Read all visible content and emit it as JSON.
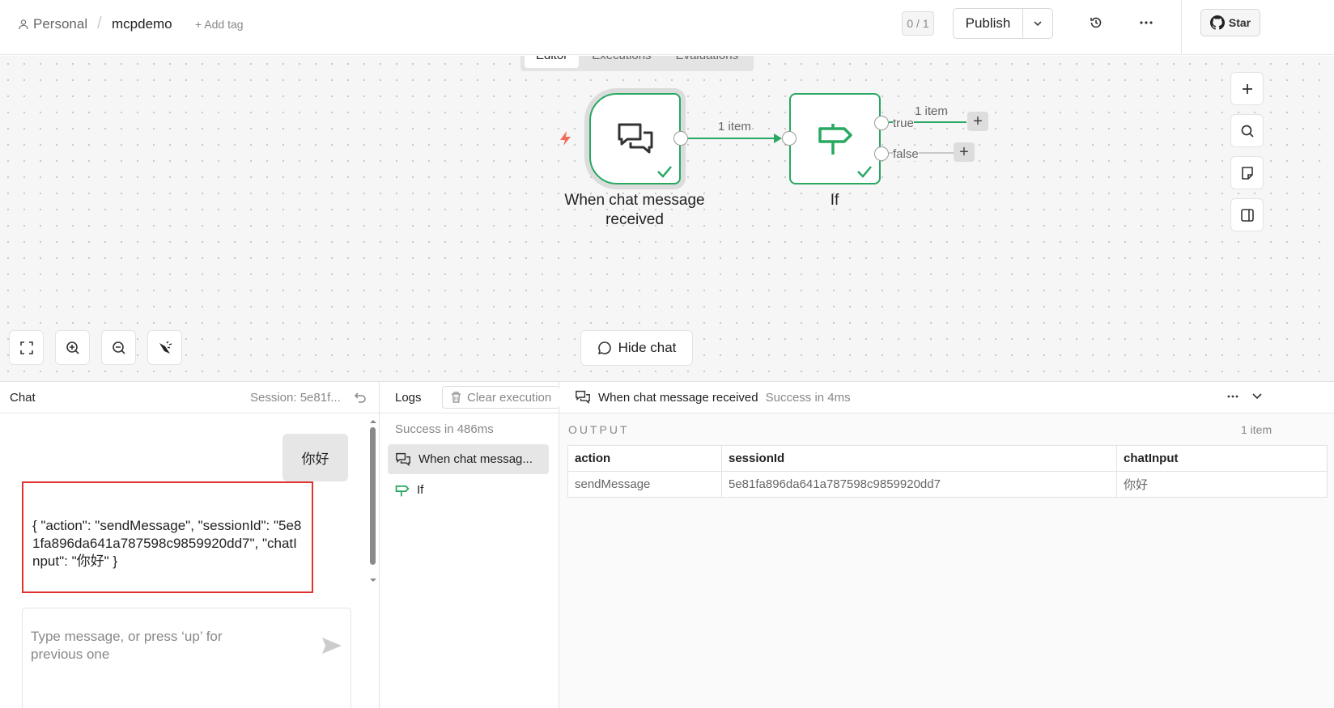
{
  "header": {
    "project": "Personal",
    "separator": "/",
    "workflow_name": "mcpdemo",
    "add_tag": "+ Add tag",
    "counter": "0 / 1",
    "publish": "Publish",
    "star": "Star"
  },
  "canvas": {
    "tabs": [
      {
        "label": "Editor",
        "active": true
      },
      {
        "label": "Executions",
        "active": false
      },
      {
        "label": "Evaluations",
        "active": false
      }
    ],
    "nodes": {
      "trigger": {
        "label": "When chat message received"
      },
      "if": {
        "label": "If"
      }
    },
    "connections": {
      "main": "1 item",
      "true_count": "1 item",
      "true_label": "true",
      "false_label": "false"
    },
    "hide_chat": "Hide chat",
    "accent": "#29a862"
  },
  "chat": {
    "title": "Chat",
    "session": "Session: 5e81f...",
    "user_message": "你好",
    "bot_message": "{ \"action\": \"sendMessage\", \"sessionId\": \"5e81fa896da641a787598c9859920dd7\", \"chatInput\": \"你好\" }",
    "input_placeholder": "Type message, or press ‘up’ for previous one"
  },
  "logs": {
    "title": "Logs",
    "clear": "Clear execution",
    "summary": "Success in 486ms",
    "items": [
      {
        "label": "When chat messag...",
        "selected": true
      },
      {
        "label": "If",
        "selected": false
      }
    ]
  },
  "output": {
    "node": "When chat message received",
    "status": "Success in 4ms",
    "label": "OUTPUT",
    "count": "1 item",
    "columns": [
      "action",
      "sessionId",
      "chatInput"
    ],
    "rows": [
      [
        "sendMessage",
        "5e81fa896da641a787598c9859920dd7",
        "你好"
      ]
    ]
  }
}
